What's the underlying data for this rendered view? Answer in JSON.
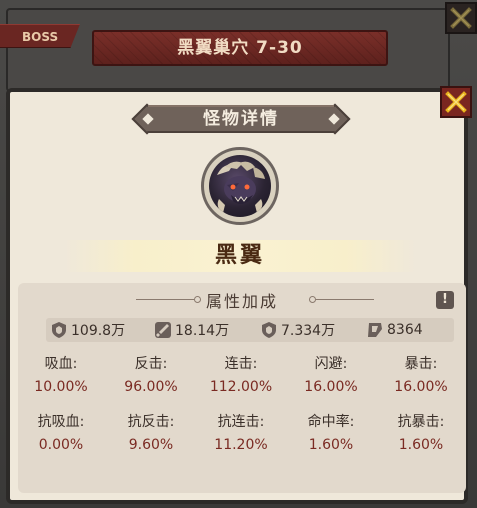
{
  "background": {
    "boss_tag": "BOSS",
    "stage_title": "黑翼巢穴 7-30"
  },
  "modal": {
    "title": "怪物详情",
    "monster_name": "黑翼",
    "attributes_title": "属性加成",
    "info_button": "!",
    "summary": [
      {
        "icon": "shield-icon",
        "value": "109.8万"
      },
      {
        "icon": "sword-icon",
        "value": "18.14万"
      },
      {
        "icon": "shield-icon",
        "value": "7.334万"
      },
      {
        "icon": "boot-icon",
        "value": "8364"
      }
    ],
    "row1": [
      {
        "label": "吸血:",
        "value": "10.00%"
      },
      {
        "label": "反击:",
        "value": "96.00%"
      },
      {
        "label": "连击:",
        "value": "112.00%"
      },
      {
        "label": "闪避:",
        "value": "16.00%"
      },
      {
        "label": "暴击:",
        "value": "16.00%"
      }
    ],
    "row2": [
      {
        "label": "抗吸血:",
        "value": "0.00%"
      },
      {
        "label": "抗反击:",
        "value": "9.60%"
      },
      {
        "label": "抗连击:",
        "value": "11.20%"
      },
      {
        "label": "命中率:",
        "value": "1.60%"
      },
      {
        "label": "抗暴击:",
        "value": "1.60%"
      }
    ]
  },
  "colors": {
    "accent_red": "#6e2824",
    "value_red": "#7a2a22",
    "panel": "#efe8da",
    "close_x": "#e8b21c"
  }
}
